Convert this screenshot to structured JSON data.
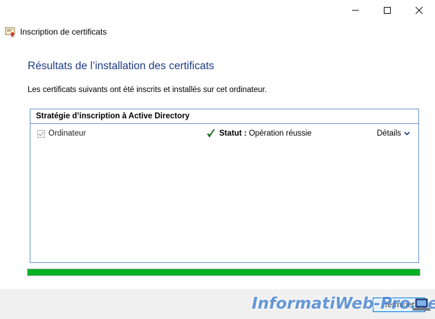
{
  "window": {
    "title": "Inscription de certificats",
    "controls": {
      "minimize": "minimize-icon",
      "maximize": "maximize-icon",
      "close": "close-icon"
    }
  },
  "page": {
    "heading": "Résultats de l’installation des certificats",
    "description": "Les certificats suivants ont été inscrits et installés sur cet ordinateur."
  },
  "policy": {
    "header": "Stratégie d’inscription à Active Directory",
    "items": [
      {
        "label": "Ordinateur",
        "checked": true,
        "status_key": "Statut :",
        "status_value": "Opération réussie",
        "status_icon": "green-checkmark-icon",
        "details_label": "Détails"
      }
    ]
  },
  "progress": {
    "value": 1.0,
    "color": "#06b025"
  },
  "footer": {
    "finish_label": "Terminer"
  },
  "watermark": {
    "text": "InformatiWeb-Pro.net"
  },
  "colors": {
    "heading": "#1c3c86",
    "border": "#6f97c8",
    "accent": "#0078d7"
  }
}
